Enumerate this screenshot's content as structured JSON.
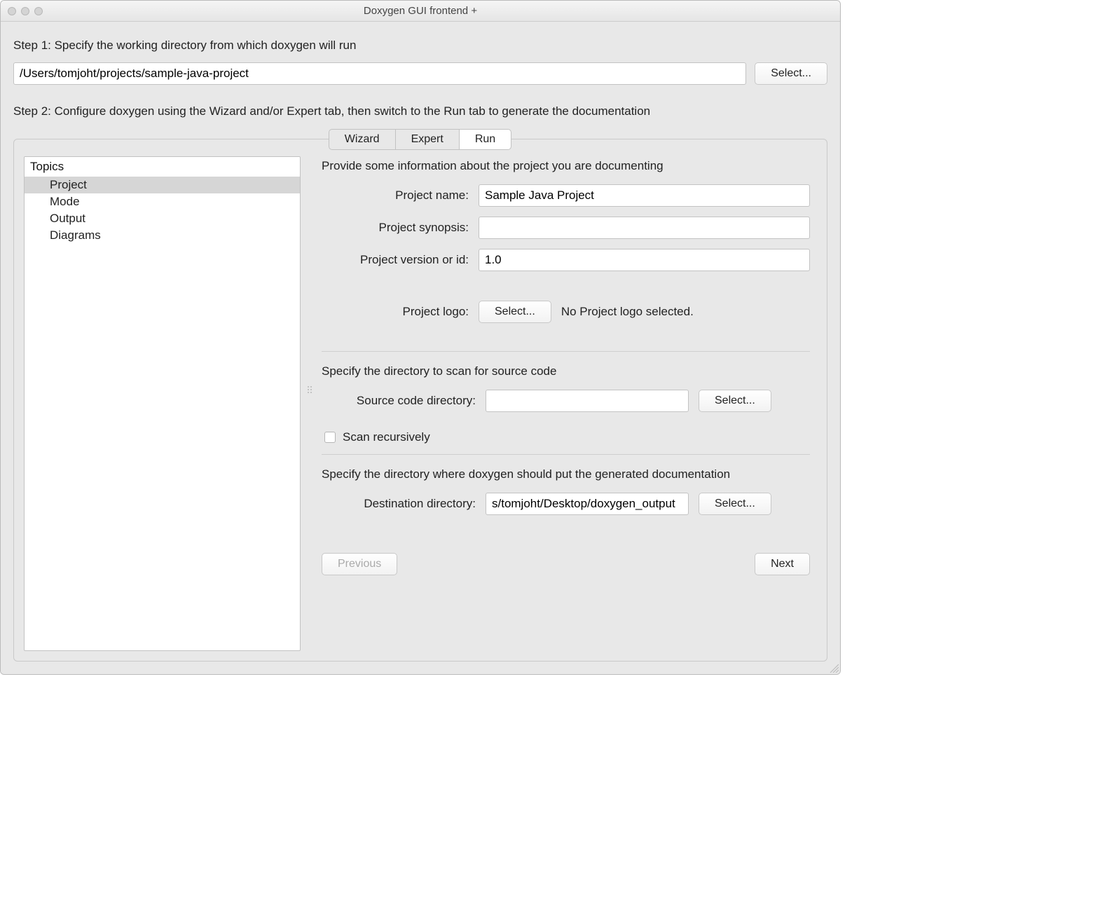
{
  "window": {
    "title": "Doxygen GUI frontend +"
  },
  "step1": {
    "label": "Step 1: Specify the working directory from which doxygen will run",
    "working_dir": "/Users/tomjoht/projects/sample-java-project",
    "select_label": "Select..."
  },
  "step2": {
    "label": "Step 2: Configure doxygen using the Wizard and/or Expert tab, then switch to the Run tab to generate the documentation"
  },
  "tabs": {
    "wizard": "Wizard",
    "expert": "Expert",
    "run": "Run"
  },
  "sidebar": {
    "header": "Topics",
    "items": [
      "Project",
      "Mode",
      "Output",
      "Diagrams"
    ]
  },
  "content": {
    "intro": "Provide some information about the project you are documenting",
    "project_name_label": "Project name:",
    "project_name_value": "Sample Java Project",
    "project_synopsis_label": "Project synopsis:",
    "project_synopsis_value": "",
    "project_version_label": "Project version or id:",
    "project_version_value": "1.0",
    "project_logo_label": "Project logo:",
    "project_logo_select": "Select...",
    "project_logo_status": "No Project logo selected.",
    "source_heading": "Specify the directory to scan for source code",
    "source_label": "Source code directory:",
    "source_value": "",
    "source_select": "Select...",
    "scan_recursively": "Scan recursively",
    "dest_heading": "Specify the directory where doxygen should put the generated documentation",
    "dest_label": "Destination directory:",
    "dest_value": "s/tomjoht/Desktop/doxygen_output",
    "dest_select": "Select...",
    "previous": "Previous",
    "next": "Next"
  }
}
